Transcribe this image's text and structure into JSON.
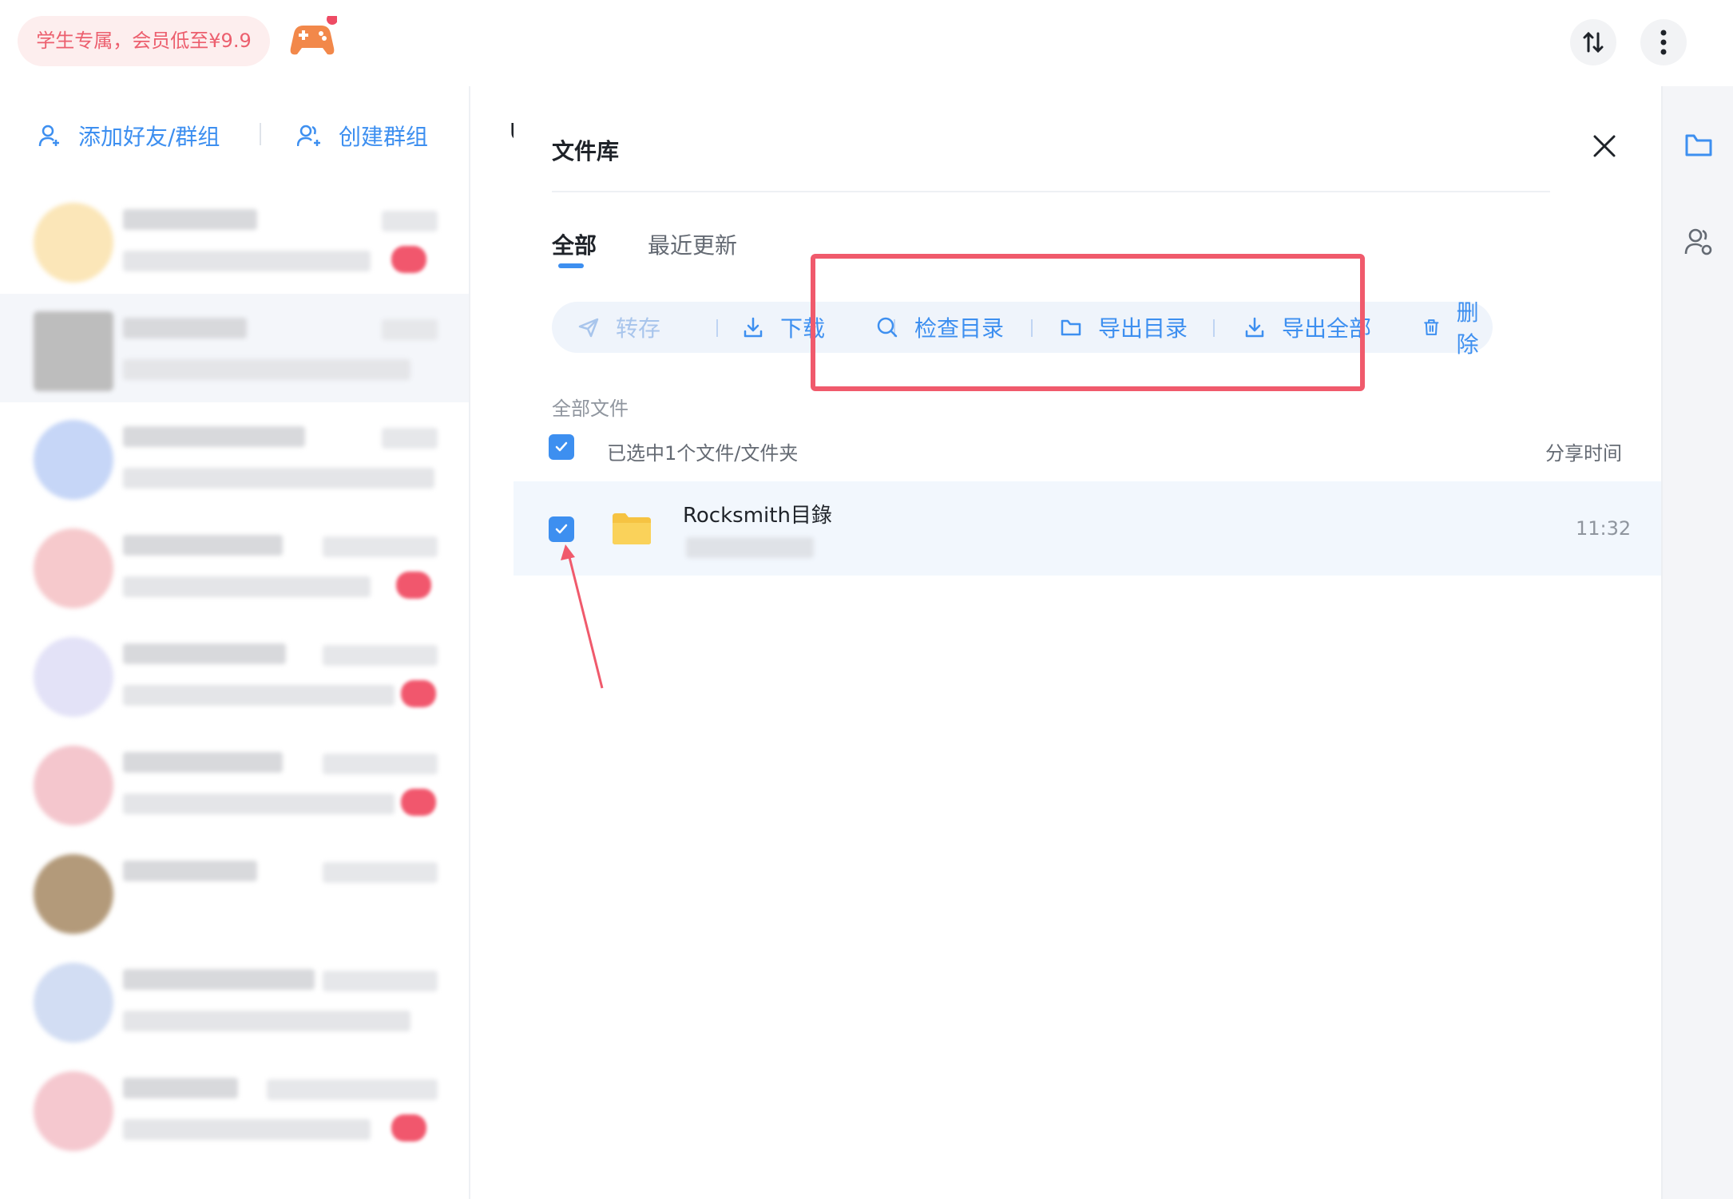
{
  "topbar": {
    "promo_text": "学生专属，会员低至¥9.9",
    "game_icon": "gamepad-icon",
    "sort_icon": "sort-arrows-icon",
    "more_icon": "more-vertical-icon"
  },
  "left_panel": {
    "add_friend_label": "添加好友/群组",
    "create_group_label": "创建群组"
  },
  "middle": {
    "partial_char": "U"
  },
  "file_library": {
    "title": "文件库",
    "tabs": [
      {
        "label": "全部",
        "active": true
      },
      {
        "label": "最近更新",
        "active": false
      }
    ],
    "toolbar": {
      "save_to": "转存",
      "download": "下载",
      "check_directory": "检查目录",
      "export_directory": "导出目录",
      "export_all": "导出全部",
      "delete": "删除"
    },
    "section_label": "全部文件",
    "selection_text": "已选中1个文件/文件夹",
    "column_share_time": "分享时间",
    "files": [
      {
        "name": "Rocksmith目錄",
        "time": "11:32",
        "selected": true,
        "icon": "folder-icon"
      }
    ]
  },
  "colors": {
    "accent": "#3d8ff0",
    "highlight": "#f05a6c",
    "promo_text": "#ec5f6e"
  }
}
